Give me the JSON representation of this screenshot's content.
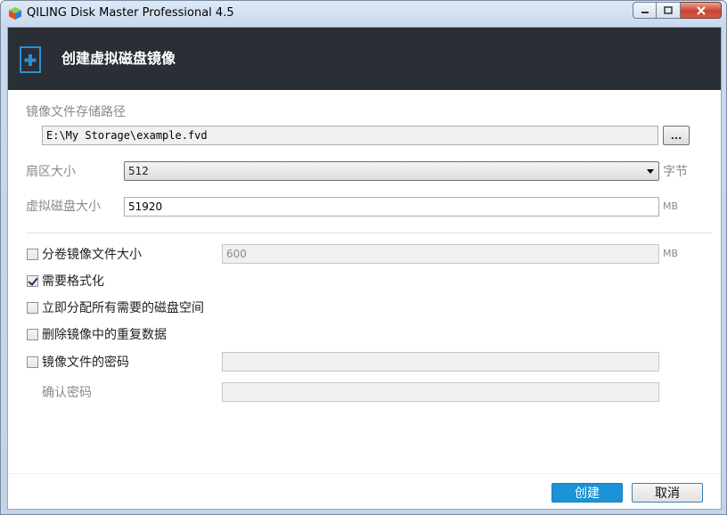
{
  "window": {
    "title": "QILING Disk Master Professional 4.5"
  },
  "header": {
    "title": "创建虚拟磁盘镜像",
    "icon": "add-disk-icon"
  },
  "form": {
    "path_label": "镜像文件存储路径",
    "path_value": "E:\\My Storage\\example.fvd",
    "browse_label": "...",
    "sector_label": "扇区大小",
    "sector_value": "512",
    "sector_unit": "字节",
    "size_label": "虚拟磁盘大小",
    "size_value": "51920",
    "size_unit": "MB",
    "split_label": "分卷镜像文件大小",
    "split_checked": false,
    "split_value": "600",
    "split_unit": "MB",
    "format_label": "需要格式化",
    "format_checked": true,
    "allocate_label": "立即分配所有需要的磁盘空间",
    "allocate_checked": false,
    "dedupe_label": "删除镜像中的重复数据",
    "dedupe_checked": false,
    "password_label": "镜像文件的密码",
    "password_checked": false,
    "password_value": "",
    "confirm_label": "确认密码",
    "confirm_value": ""
  },
  "footer": {
    "create_label": "创建",
    "cancel_label": "取消"
  },
  "colors": {
    "header_bg": "#2a2e35",
    "primary_button": "#1b93d6",
    "accent_icon": "#2a8fd6"
  }
}
